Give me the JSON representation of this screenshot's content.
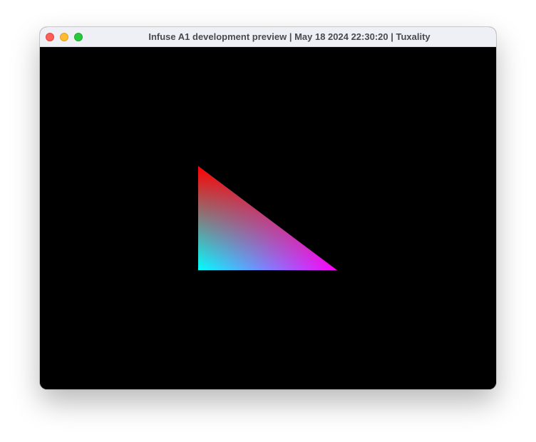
{
  "window": {
    "title": "Infuse A1 development preview | May 18 2024 22:30:20 | Tuxality"
  },
  "traffic_lights": {
    "close_color": "#ff5f57",
    "minimize_color": "#febc2e",
    "maximize_color": "#28c840"
  },
  "scene": {
    "background_color": "#000000",
    "triangle": {
      "vertex_colors": {
        "top": "#ff0000",
        "bottom_left": "#00ffff",
        "bottom_right": "#ff00ff"
      }
    }
  }
}
